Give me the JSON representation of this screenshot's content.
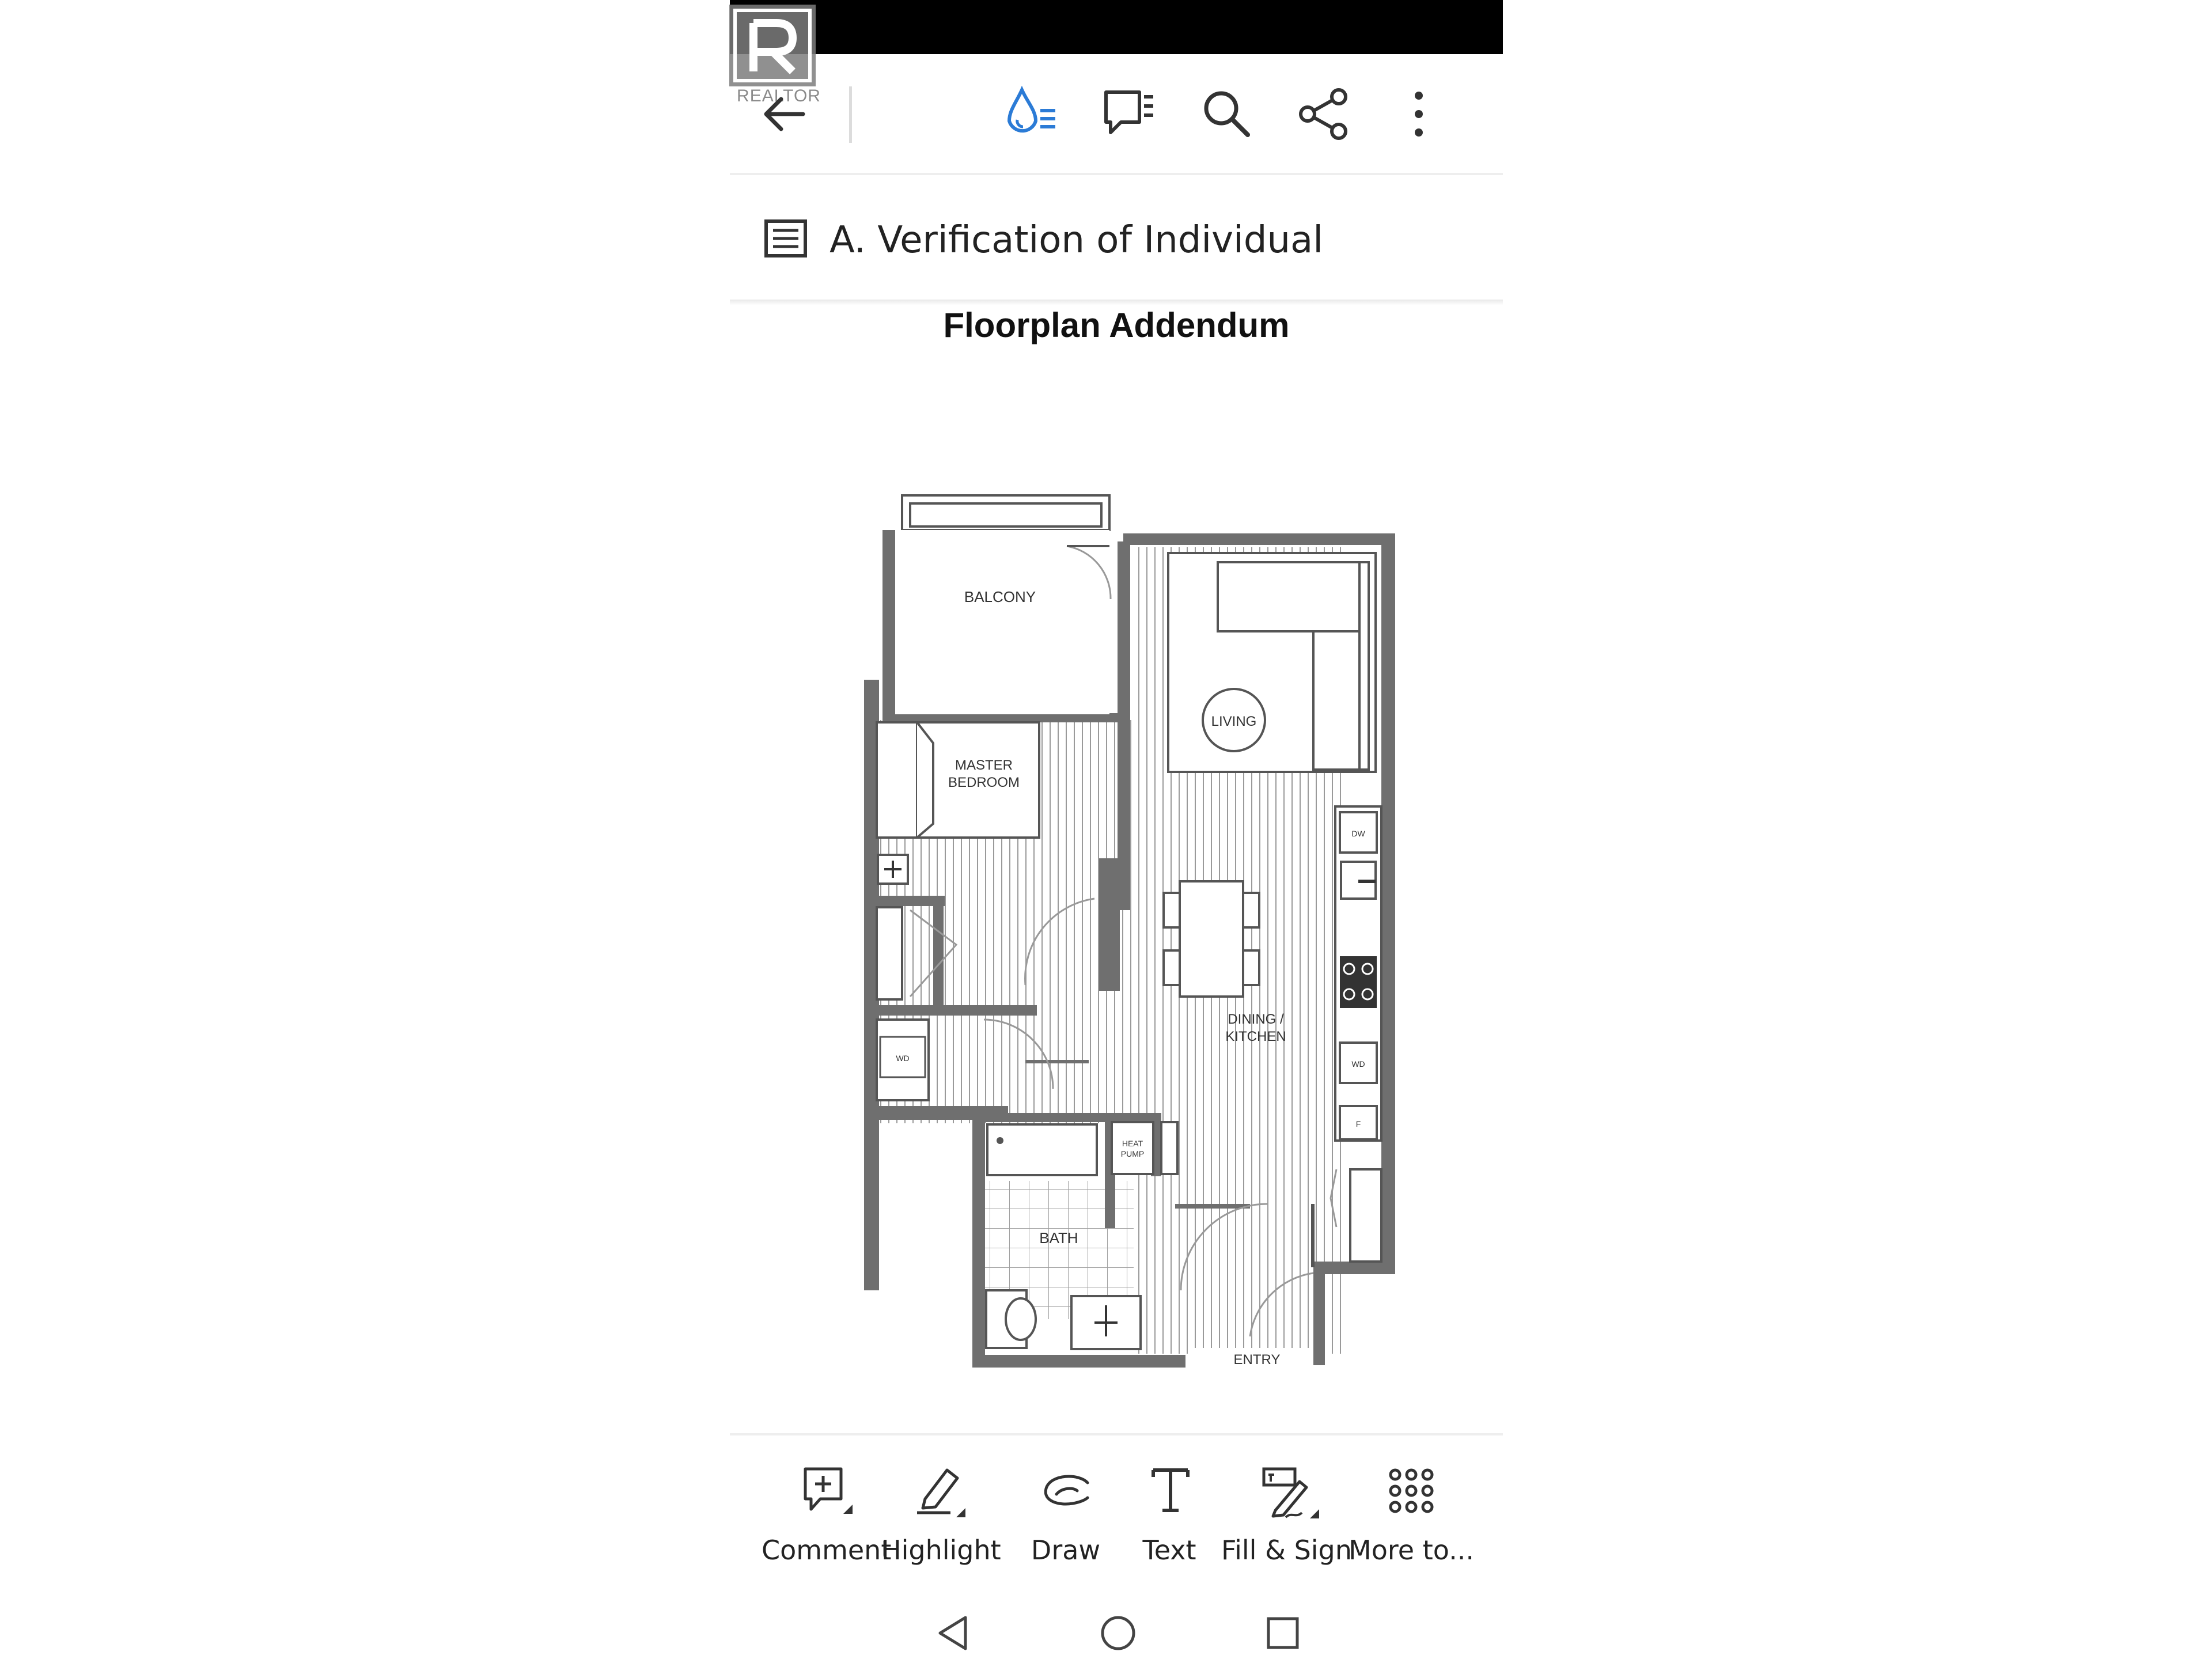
{
  "app": {
    "section_title": "A. Verification of Individual",
    "document_heading": "Floorplan Addendum"
  },
  "watermark": {
    "text": "REALTOR"
  },
  "topbar": {
    "icons": [
      "back-arrow-icon",
      "liquid-mode-icon",
      "comment-list-icon",
      "search-icon",
      "share-icon",
      "more-vertical-icon"
    ]
  },
  "floorplan": {
    "rooms": {
      "balcony": "BALCONY",
      "living": "LIVING",
      "master_line1": "MASTER",
      "master_line2": "BEDROOM",
      "dining_line1": "DINING /",
      "dining_line2": "KITCHEN",
      "bath": "BATH",
      "entry": "ENTRY",
      "heat_line1": "HEAT",
      "heat_line2": "PUMP",
      "wd": "WD",
      "dw": "DW",
      "f": "F"
    }
  },
  "toolbar": {
    "comment": "Comment",
    "highlight": "Highlight",
    "draw": "Draw",
    "text": "Text",
    "fill_sign": "Fill & Sign",
    "more": "More to..."
  },
  "navbar": {
    "icons": [
      "nav-back-icon",
      "nav-home-icon",
      "nav-recents-icon"
    ]
  },
  "colors": {
    "accent": "#2b7bd6",
    "wall": "#6f6f6f",
    "icon": "#333333"
  }
}
